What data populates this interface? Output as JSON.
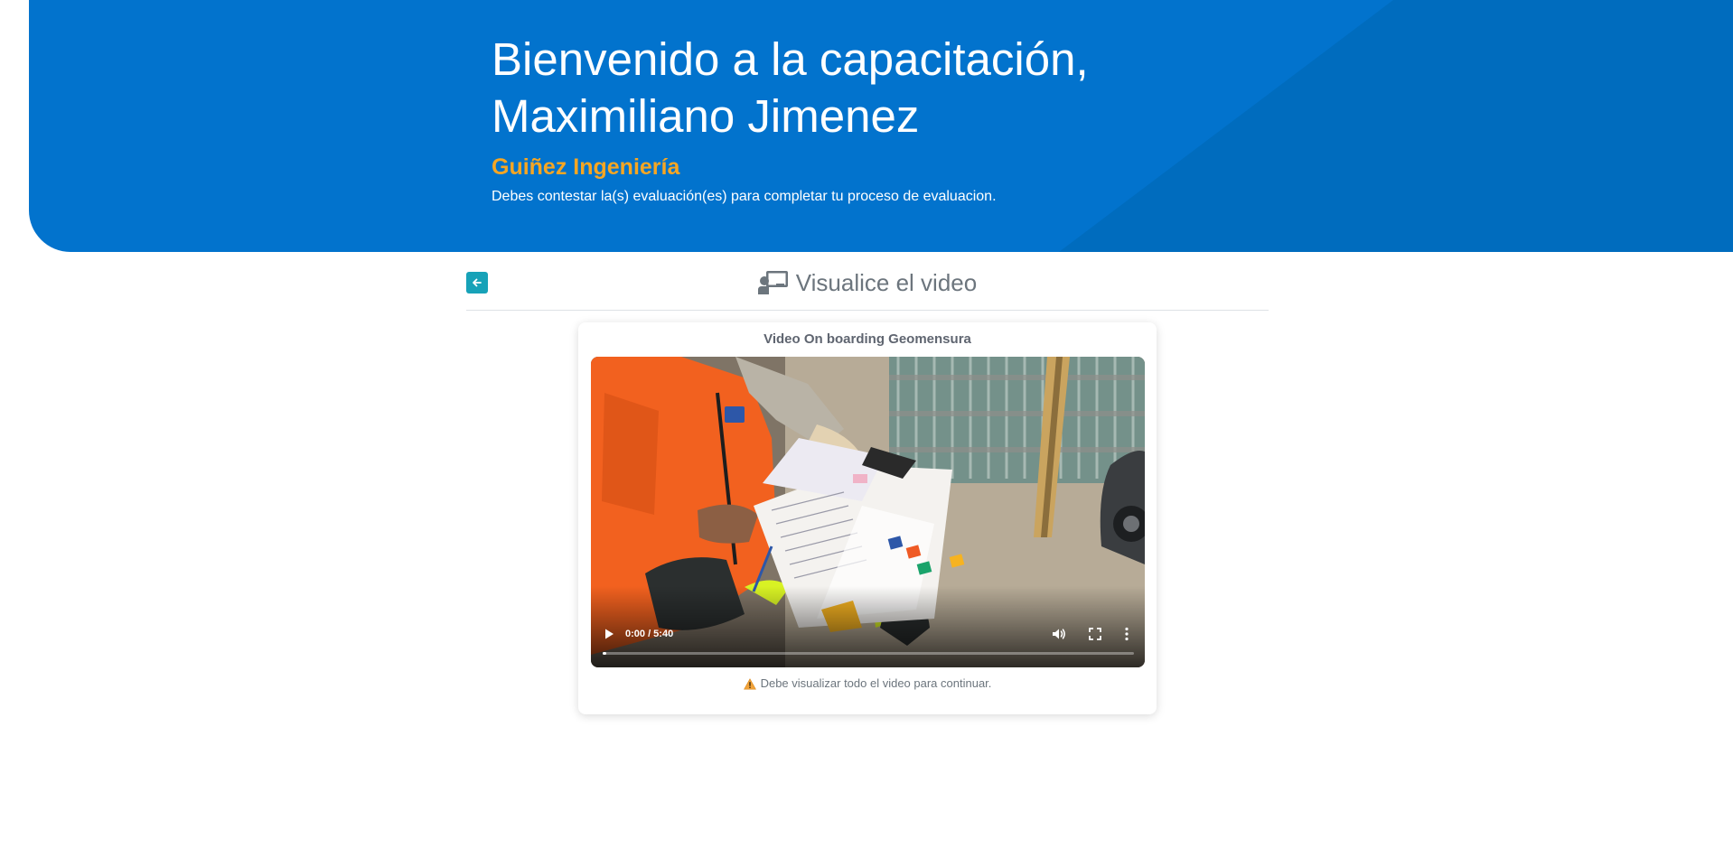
{
  "header": {
    "title_line1": "Bienvenido a la capacitación,",
    "title_line2": "Maximiliano Jimenez",
    "company": "Guiñez Ingeniería",
    "subtitle": "Debes contestar la(s) evaluación(es) para completar tu proceso de evaluacion."
  },
  "section": {
    "title": "Visualice el video",
    "back_icon": "arrow-left-icon",
    "title_icon": "chalkboard-teacher-icon"
  },
  "video": {
    "title": "Video On boarding Geomensura",
    "time": "0:00 / 5:40",
    "progress": 0,
    "controls": [
      "play-icon",
      "volume-icon",
      "fullscreen-icon",
      "more-options-icon"
    ]
  },
  "warning": {
    "icon": "warning-icon",
    "text": "Debe visualizar todo el video para continuar."
  },
  "colors": {
    "header_bg": "#0273cd",
    "company": "#f6a623",
    "back_button": "#17a2b8",
    "muted_text": "#6c757d"
  }
}
